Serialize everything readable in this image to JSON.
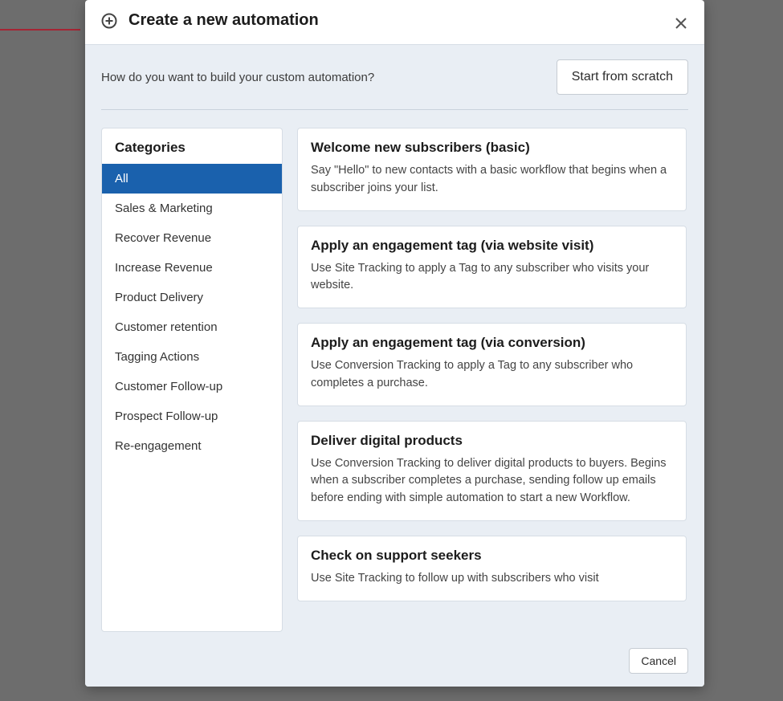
{
  "header": {
    "title": "Create a new automation"
  },
  "top": {
    "prompt": "How do you want to build your custom automation?",
    "scratch_label": "Start from scratch"
  },
  "categories": {
    "title": "Categories",
    "items": [
      "All",
      "Sales & Marketing",
      "Recover Revenue",
      "Increase Revenue",
      "Product Delivery",
      "Customer retention",
      "Tagging Actions",
      "Customer Follow-up",
      "Prospect Follow-up",
      "Re-engagement"
    ],
    "active_index": 0
  },
  "templates": [
    {
      "title": "Welcome new subscribers (basic)",
      "desc": "Say \"Hello\" to new contacts with a basic workflow that begins when a subscriber joins your list."
    },
    {
      "title": "Apply an engagement tag (via website visit)",
      "desc": "Use Site Tracking to apply a Tag to any subscriber who visits your website."
    },
    {
      "title": "Apply an engagement tag (via conversion)",
      "desc": "Use Conversion Tracking to apply a Tag to any subscriber who completes a purchase."
    },
    {
      "title": "Deliver digital products",
      "desc": "Use Conversion Tracking to deliver digital products to buyers. Begins when a subscriber completes a purchase, sending follow up emails before ending with simple automation to start a new Workflow."
    },
    {
      "title": "Check on support seekers",
      "desc": "Use Site Tracking to follow up with subscribers who visit"
    }
  ],
  "footer": {
    "cancel_label": "Cancel"
  }
}
